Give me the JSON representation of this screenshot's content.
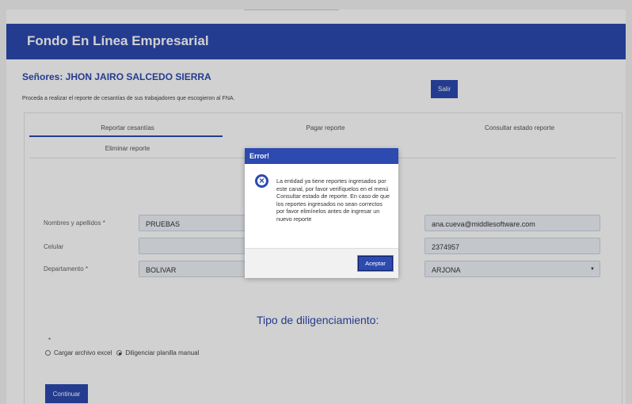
{
  "app": {
    "title": "Fondo En Línea Empresarial"
  },
  "user": {
    "greeting": "Señores: JHON JAIRO SALCEDO SIERRA"
  },
  "instructions": "Proceda a realizar el reporte de cesantías de sus trabajadores que escogieron al FNA.",
  "buttons": {
    "salir": "Salir",
    "continuar": "Continuar"
  },
  "tabs": [
    {
      "label": "Reportar cesantías",
      "active": true
    },
    {
      "label": "Pagar reporte",
      "active": false
    },
    {
      "label": "Consultar estado reporte",
      "active": false
    },
    {
      "label": "Eliminar reporte",
      "active": false
    }
  ],
  "form": {
    "nombres_label": "Nombres y apellidos *",
    "nombres_value": "PRUEBAS",
    "celular_label": "Celular",
    "celular_value": "",
    "departamento_label": "Departamento *",
    "departamento_value": "BOLIVAR",
    "email_value": "ana.cueva@middlesoftware.com",
    "telefono_value": "2374957",
    "municipio_value": "ARJONA"
  },
  "section": {
    "title": "Tipo de diligenciamiento:",
    "required_mark": "*"
  },
  "options": [
    {
      "label": "Cargar archivo excel",
      "checked": false
    },
    {
      "label": "Diligenciar planilla manual",
      "checked": true
    }
  ],
  "modal": {
    "title": "Error!",
    "icon": "error-circle-x-icon",
    "message": "La entidad ya tiene reportes ingresados por este canal, por favor verifíquelos en el menú Consultar estado de reporte. En caso de que los reportes ingresados no sean correctos por favor elimínelos antes de ingresar un nuevo reporte",
    "accept": "Aceptar"
  },
  "colors": {
    "brand": "#2c4aaf",
    "field_bg": "#eef2f8"
  }
}
